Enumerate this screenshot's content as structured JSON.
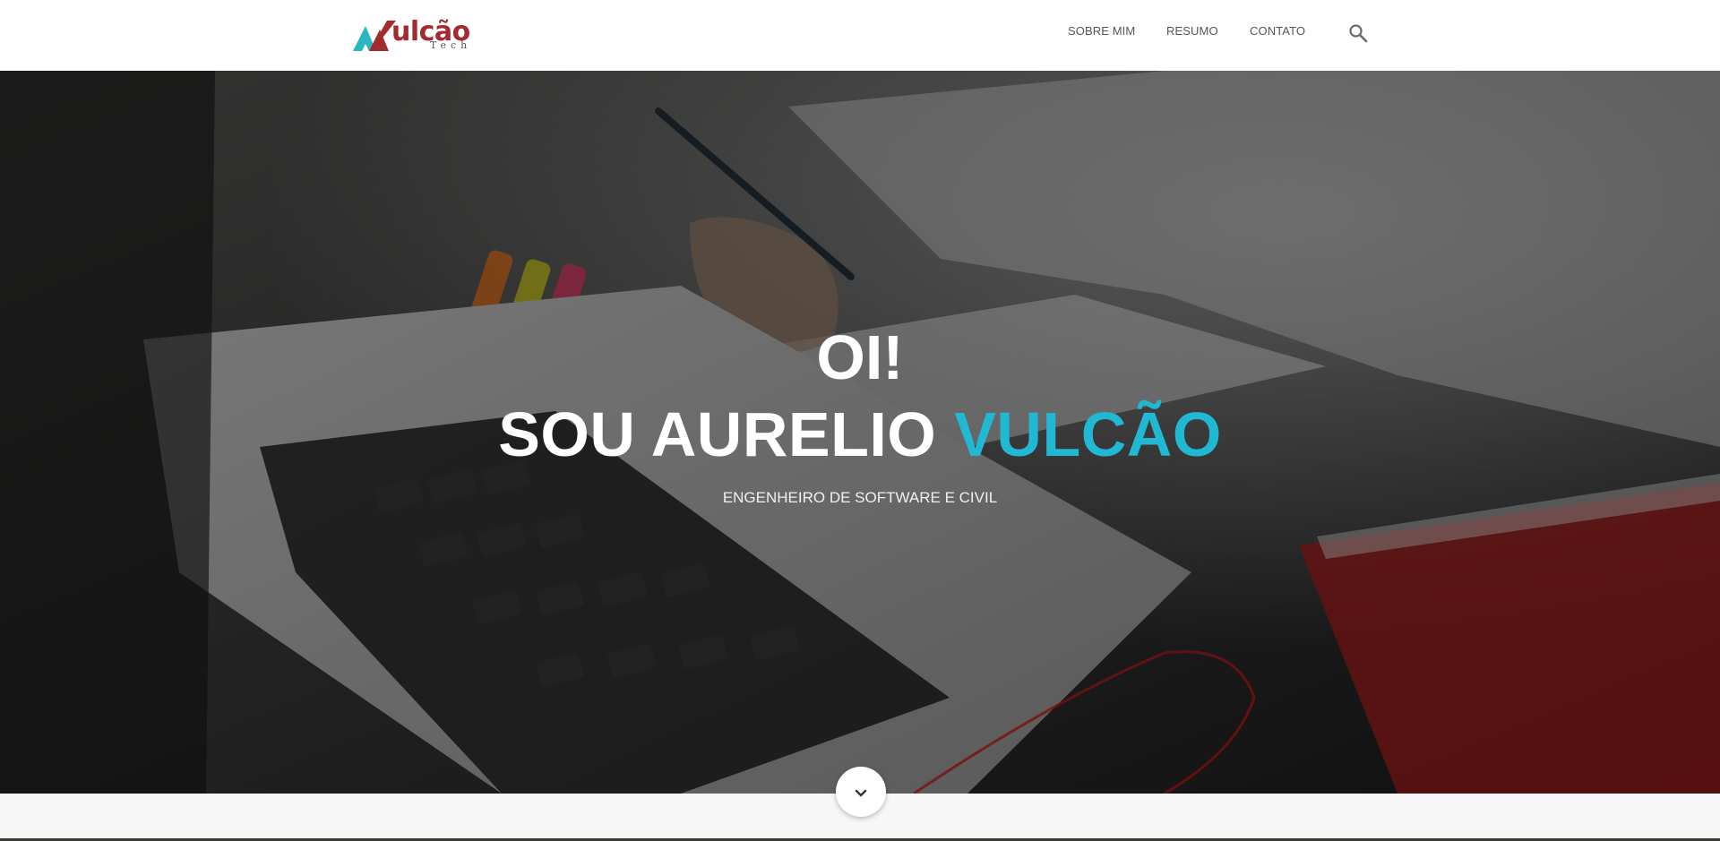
{
  "header": {
    "logo": {
      "word": "ulcão",
      "sub": "Tech",
      "colors": {
        "teal": "#2ab7c4",
        "red": "#a32b2f"
      }
    },
    "nav": [
      {
        "label": "SOBRE MIM"
      },
      {
        "label": "RESUMO"
      },
      {
        "label": "CONTATO"
      }
    ],
    "search_icon": "search-icon"
  },
  "hero": {
    "greeting": "OI!",
    "name_prefix": "SOU AURELIO ",
    "name_accent": "VULCÃO",
    "subtitle": "ENGENHEIRO DE SOFTWARE E CIVIL",
    "accent_color": "#20b8d2",
    "background": "laptop-desk-photo"
  },
  "scroll_button": {
    "icon": "chevron-down-icon"
  }
}
